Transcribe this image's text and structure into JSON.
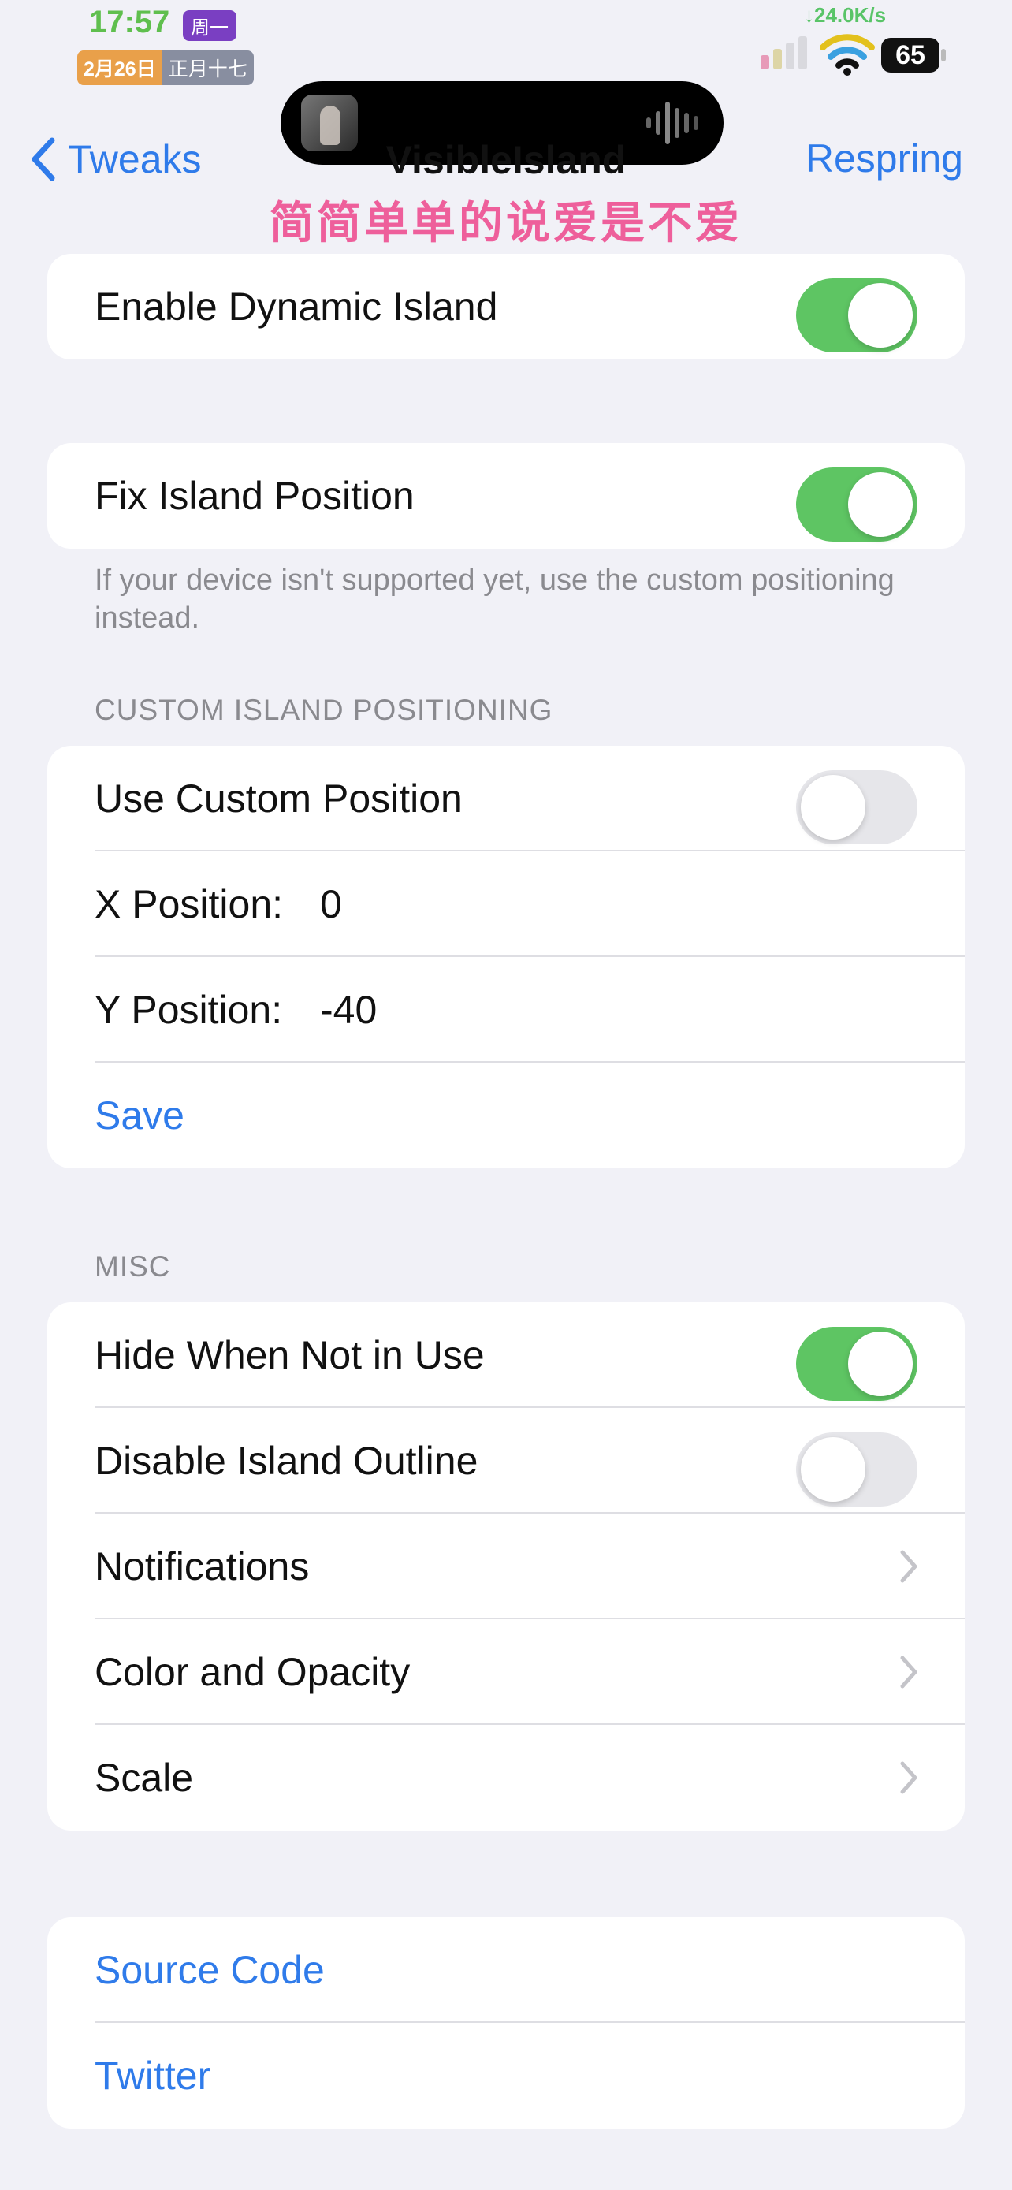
{
  "status": {
    "time": "17:57",
    "weekday": "周一",
    "date_gregorian": "2月26日",
    "date_lunar": "正月十七",
    "net_speed": "↓24.0K/s",
    "battery": "65",
    "accent_time": "#5fbf4e"
  },
  "nav": {
    "back_label": "Tweaks",
    "title": "VisibleIsland",
    "right_button": "Respring"
  },
  "overlay_lyrics": "简简单单的说爱是不爱",
  "sections": {
    "enable": {
      "label": "Enable Dynamic Island",
      "on": true
    },
    "fix": {
      "label": "Fix Island Position",
      "on": true,
      "footer": "If your device isn't supported yet, use the custom positioning instead."
    },
    "custom": {
      "header": "CUSTOM ISLAND POSITIONING",
      "use_custom": {
        "label": "Use Custom Position",
        "on": false
      },
      "x": {
        "label": "X Position:",
        "value": "0"
      },
      "y": {
        "label": "Y Position:",
        "value": "-40"
      },
      "save_label": "Save"
    },
    "misc": {
      "header": "MISC",
      "hide": {
        "label": "Hide When Not in Use",
        "on": true
      },
      "outline": {
        "label": "Disable Island Outline",
        "on": false
      },
      "items": [
        "Notifications",
        "Color and Opacity",
        "Scale"
      ]
    },
    "links": [
      "Source Code",
      "Twitter"
    ]
  },
  "colors": {
    "accent": "#2f7bea",
    "toggle_on": "#5ec563",
    "background": "#f1f1f7"
  }
}
